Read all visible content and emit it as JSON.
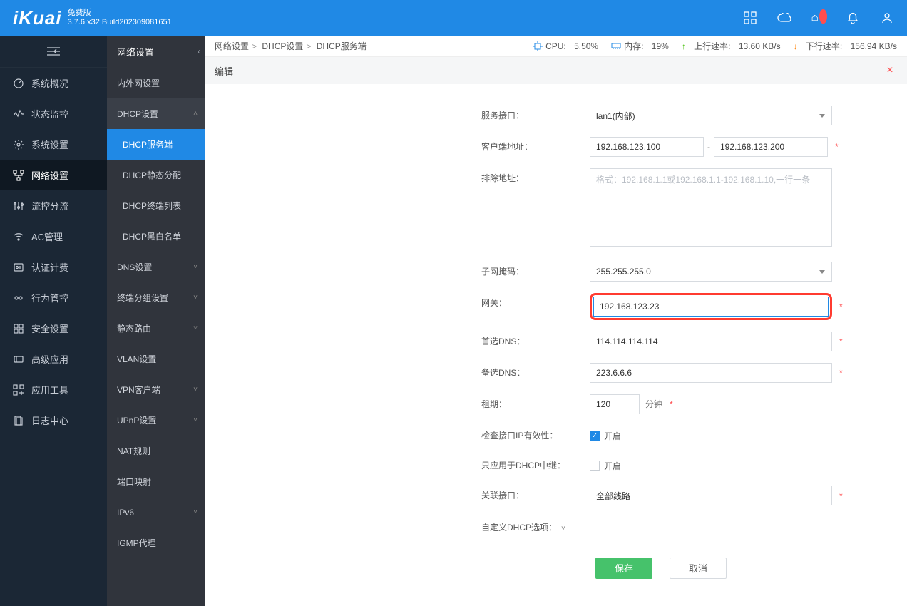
{
  "header": {
    "logo": "iKuai",
    "edition": "免费版",
    "build": "3.7.6 x32 Build202309081651"
  },
  "nav_left": {
    "items": [
      {
        "icon": "dashboard",
        "label": "系统概况"
      },
      {
        "icon": "monitor",
        "label": "状态监控"
      },
      {
        "icon": "gear",
        "label": "系统设置"
      },
      {
        "icon": "network",
        "label": "网络设置",
        "active": true
      },
      {
        "icon": "flow",
        "label": "流控分流"
      },
      {
        "icon": "wifi",
        "label": "AC管理"
      },
      {
        "icon": "auth",
        "label": "认证计费"
      },
      {
        "icon": "behavior",
        "label": "行为管控"
      },
      {
        "icon": "security",
        "label": "安全设置"
      },
      {
        "icon": "advanced",
        "label": "高级应用"
      },
      {
        "icon": "tools",
        "label": "应用工具"
      },
      {
        "icon": "log",
        "label": "日志中心"
      }
    ]
  },
  "nav_sub": {
    "header": "网络设置",
    "groups": [
      {
        "label": "内外网设置",
        "type": "item"
      },
      {
        "label": "DHCP设置",
        "type": "expand",
        "children": [
          {
            "label": "DHCP服务端",
            "active": true
          },
          {
            "label": "DHCP静态分配"
          },
          {
            "label": "DHCP终端列表"
          },
          {
            "label": "DHCP黑白名单"
          }
        ]
      },
      {
        "label": "DNS设置",
        "type": "collapse"
      },
      {
        "label": "终端分组设置",
        "type": "collapse"
      },
      {
        "label": "静态路由",
        "type": "collapse"
      },
      {
        "label": "VLAN设置",
        "type": "item"
      },
      {
        "label": "VPN客户端",
        "type": "collapse"
      },
      {
        "label": "UPnP设置",
        "type": "collapse"
      },
      {
        "label": "NAT规则",
        "type": "item"
      },
      {
        "label": "端口映射",
        "type": "item"
      },
      {
        "label": "IPv6",
        "type": "collapse"
      },
      {
        "label": "IGMP代理",
        "type": "item"
      }
    ]
  },
  "breadcrumb": [
    "网络设置",
    "DHCP设置",
    "DHCP服务端"
  ],
  "status": {
    "cpu_label": "CPU:",
    "cpu_value": "5.50%",
    "mem_label": "内存:",
    "mem_value": "19%",
    "up_label": "上行速率:",
    "up_value": "13.60 KB/s",
    "down_label": "下行速率:",
    "down_value": "156.94 KB/s"
  },
  "edit_title": "编辑",
  "form": {
    "iface_label": "服务接口：",
    "iface_value": "lan1(内部)",
    "client_label": "客户端地址：",
    "client_start": "192.168.123.100",
    "client_end": "192.168.123.200",
    "exclude_label": "排除地址：",
    "exclude_placeholder": "格式：192.168.1.1或192.168.1.1-192.168.1.10,一行一条",
    "mask_label": "子网掩码：",
    "mask_value": "255.255.255.0",
    "gw_label": "网关：",
    "gw_value": "192.168.123.23",
    "dns1_label": "首选DNS：",
    "dns1_value": "114.114.114.114",
    "dns2_label": "备选DNS：",
    "dns2_value": "223.6.6.6",
    "lease_label": "租期：",
    "lease_value": "120",
    "lease_unit": "分钟",
    "checkip_label": "检查接口IP有效性：",
    "checkip_on": "开启",
    "relay_label": "只应用于DHCP中继：",
    "relay_on": "开启",
    "assoc_label": "关联接口：",
    "assoc_value": "全部线路",
    "custom_label": "自定义DHCP选项：",
    "btn_save": "保存",
    "btn_cancel": "取消"
  }
}
